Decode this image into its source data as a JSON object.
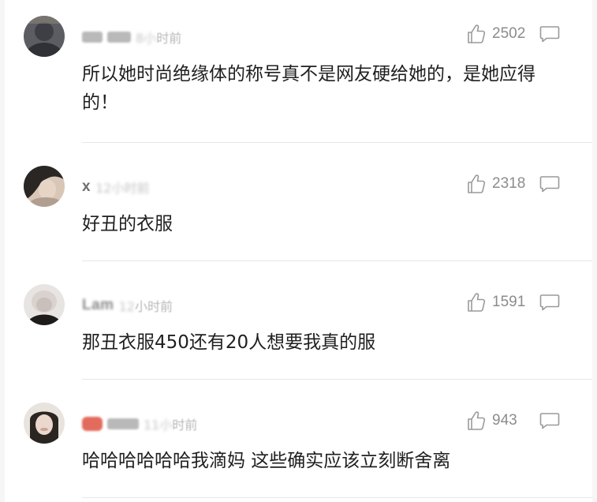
{
  "comments": [
    {
      "username": "",
      "time": "时前",
      "time_blurred": "8小",
      "likes": "2502",
      "text": "所以她时尚绝缘体的称号真不是网友硬给她的，是她应得的！",
      "avatar_colors": [
        "#3d3f45",
        "#8a8479",
        "#c9c2b8"
      ]
    },
    {
      "username": "x",
      "time": "时前",
      "time_blurred": "12小",
      "likes": "2318",
      "text": "好丑的衣服",
      "avatar_colors": [
        "#2a2623",
        "#d8c7b6",
        "#b09f90"
      ]
    },
    {
      "username": "Lam",
      "time": "小时前",
      "time_blurred": "12",
      "likes": "1591",
      "text": "那丑衣服450还有20人想要我真的服",
      "avatar_colors": [
        "#e8e4e1",
        "#c9bfbb",
        "#1e1c1b"
      ]
    },
    {
      "username": "",
      "time": "时前",
      "time_blurred": "11小",
      "likes": "943",
      "text": "哈哈哈哈哈哈我滴妈 这些确实应该立刻断舍离",
      "avatar_colors": [
        "#e9e3de",
        "#2b2522",
        "#c8a595"
      ]
    }
  ]
}
